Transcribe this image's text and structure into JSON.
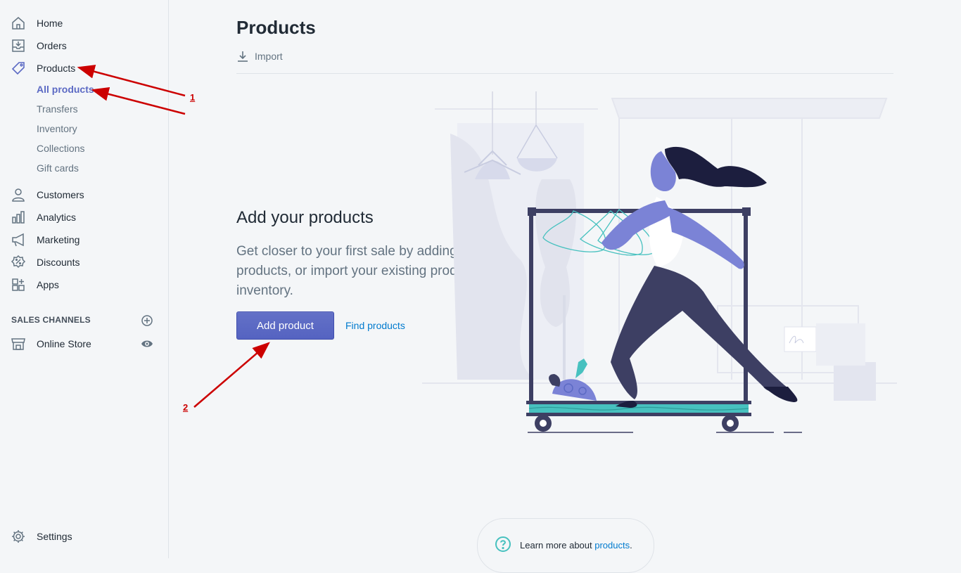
{
  "sidebar": {
    "items": [
      {
        "label": "Home",
        "icon": "home-icon"
      },
      {
        "label": "Orders",
        "icon": "orders-icon"
      },
      {
        "label": "Products",
        "icon": "tag-icon"
      },
      {
        "label": "Customers",
        "icon": "person-icon"
      },
      {
        "label": "Analytics",
        "icon": "bar-chart-icon"
      },
      {
        "label": "Marketing",
        "icon": "megaphone-icon"
      },
      {
        "label": "Discounts",
        "icon": "discount-icon"
      },
      {
        "label": "Apps",
        "icon": "apps-icon"
      }
    ],
    "products_sub": [
      "All products",
      "Transfers",
      "Inventory",
      "Collections",
      "Gift cards"
    ],
    "sales_channels_title": "SALES CHANNELS",
    "online_store": "Online Store",
    "settings": "Settings"
  },
  "main": {
    "title": "Products",
    "import_label": "Import",
    "empty_state": {
      "heading": "Add your products",
      "description": "Get closer to your first sale by adding products, or import your existing product inventory.",
      "primary_button": "Add product",
      "secondary_link": "Find products"
    },
    "footer": {
      "text": "Learn more about ",
      "link": "products",
      "suffix": "."
    }
  },
  "annotations": {
    "marker_1": "1",
    "marker_2": "2"
  },
  "colors": {
    "accent": "#5c6ac4",
    "link": "#007ace",
    "annotation": "#cc0000",
    "teal": "#47c1bf"
  }
}
